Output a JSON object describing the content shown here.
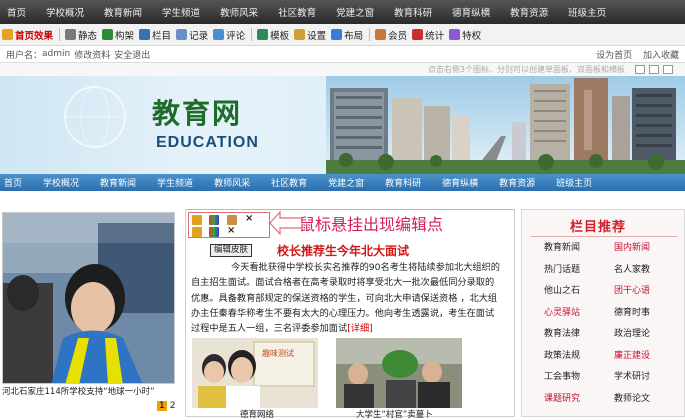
{
  "top_nav": [
    "首页",
    "学校概况",
    "教育新闻",
    "学生频道",
    "教师风采",
    "社区教育",
    "党建之窗",
    "教育科研",
    "德育纵横",
    "教育资源",
    "班级主页"
  ],
  "toolbar": [
    {
      "label": "首页效果",
      "icon": "home-icon",
      "color": "#e8a020"
    },
    {
      "label": "静态",
      "icon": "lightning-icon",
      "color": "#7a7a7a"
    },
    {
      "label": "构架",
      "icon": "structure-icon",
      "color": "#2e8b3a"
    },
    {
      "label": "栏目",
      "icon": "column-icon",
      "color": "#3a6fb0"
    },
    {
      "label": "记录",
      "icon": "record-icon",
      "color": "#6a8fc8"
    },
    {
      "label": "评论",
      "icon": "comment-icon",
      "color": "#4a90d0"
    },
    {
      "label": "模板",
      "icon": "template-icon",
      "color": "#2e8b57"
    },
    {
      "label": "设置",
      "icon": "settings-icon",
      "color": "#d0a030"
    },
    {
      "label": "布局",
      "icon": "layout-icon",
      "color": "#3a7bd5"
    },
    {
      "label": "会员",
      "icon": "member-icon",
      "color": "#c87830"
    },
    {
      "label": "统计",
      "icon": "stats-icon",
      "color": "#c83030"
    },
    {
      "label": "特权",
      "icon": "privilege-icon",
      "color": "#8a5ad0"
    }
  ],
  "userbar": {
    "prefix": "用户名：",
    "username": "admin",
    "edit_profile": "修改资料",
    "logout": "安全退出",
    "set_homepage": "设为首页",
    "add_favorite": "加入收藏"
  },
  "hint_text": "点击右侧3个图标，分别可以创建单面板、双面板和横板",
  "banner": {
    "title_cn": "教育网",
    "title_en": "EDUCATION"
  },
  "main_nav": [
    "首页",
    "学校概况",
    "教育新闻",
    "学生频道",
    "教师风采",
    "社区教育",
    "党建之窗",
    "教育科研",
    "德育纵横",
    "教育资源",
    "班级主页"
  ],
  "photo": {
    "caption": "河北石家庄114所学校支持“地球一小时”",
    "pages": [
      "1",
      "2"
    ]
  },
  "editor": {
    "skin_button": "编辑皮肤",
    "hover_hint": "鼠标悬挂出现编辑点"
  },
  "news": {
    "headline": "校长推荐生今年北大面试",
    "body": "今天看批获得中学校长实名推荐的90名考生将陆续参加北大组织的自主招生面试。面试合格者在高考录取时将享受北大一批次最低同分录取的优惠。具备教育部规定的保送资格的学生，可向北大申请保送资格 ，北大组办主任秦春华称考生不要有太大的心理压力。他向考生透露说，考生在面试过程中是五人一组，三名评委参加面试",
    "more": "[详细]"
  },
  "thumbs": [
    {
      "caption": "德育网络",
      "sign_text": "趣味测试"
    },
    {
      "caption": "大学生“村官”卖蔓卜"
    }
  ],
  "right_column": {
    "title": "栏目推荐",
    "items": [
      {
        "label": "教育新闻",
        "red": false
      },
      {
        "label": "国内新闻",
        "red": true
      },
      {
        "label": "热门话题",
        "red": false
      },
      {
        "label": "名人家教",
        "red": false
      },
      {
        "label": "他山之石",
        "red": false
      },
      {
        "label": "团干心语",
        "red": true
      },
      {
        "label": "心灵驿站",
        "red": true
      },
      {
        "label": "德育时事",
        "red": false
      },
      {
        "label": "教育法律",
        "red": false
      },
      {
        "label": "政治理论",
        "red": false
      },
      {
        "label": "政策法规",
        "red": false
      },
      {
        "label": "廉正建设",
        "red": true
      },
      {
        "label": "工会事物",
        "red": false
      },
      {
        "label": "学术研讨",
        "red": false
      },
      {
        "label": "课题研究",
        "red": true
      },
      {
        "label": "教师论文",
        "red": false
      }
    ]
  }
}
